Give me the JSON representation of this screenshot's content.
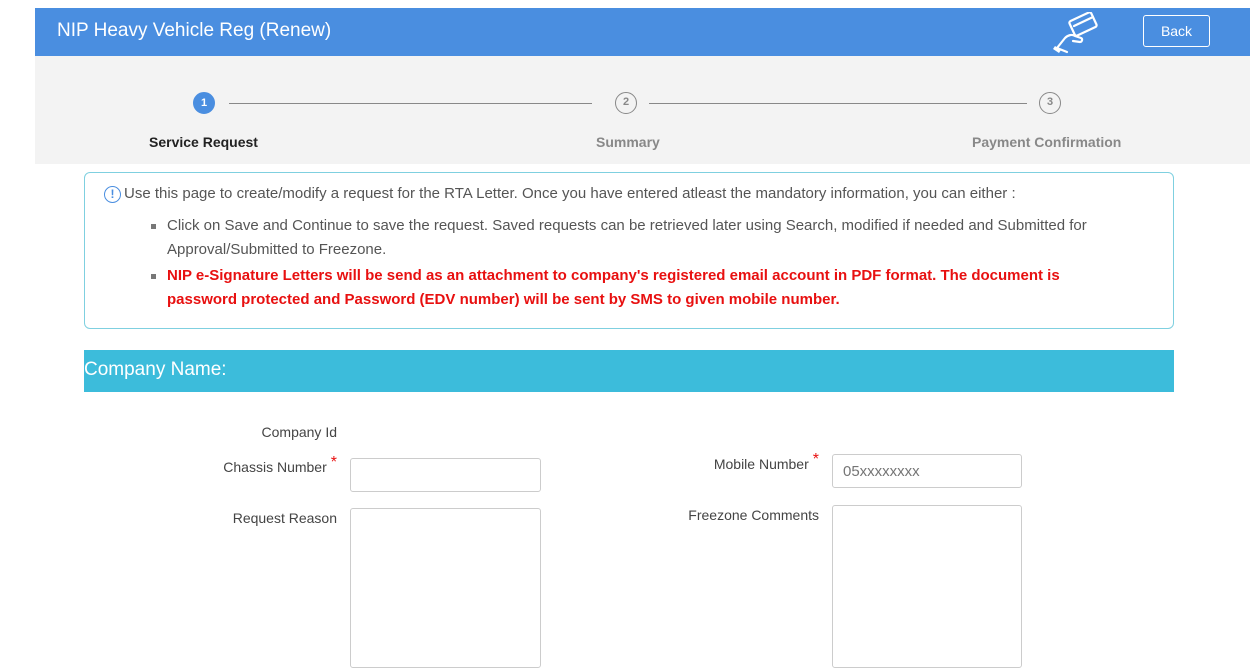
{
  "header": {
    "title": "NIP Heavy Vehicle Reg (Renew)",
    "back_label": "Back",
    "icon": "card-payment-icon"
  },
  "steps": [
    {
      "number": "1",
      "label": "Service Request",
      "active": true
    },
    {
      "number": "2",
      "label": "Summary",
      "active": false
    },
    {
      "number": "3",
      "label": "Payment Confirmation",
      "active": false
    }
  ],
  "info": {
    "intro": "Use this page to create/modify a request for the RTA Letter. Once you have entered atleast the mandatory information, you can either :",
    "bullets": [
      "Click on Save and Continue to save the request. Saved requests can be retrieved later using Search, modified if needed and Submitted for Approval/Submitted to Freezone.",
      "NIP e-Signature Letters will be send as an attachment to company's registered email account in PDF format. The document is password protected and Password (EDV number) will be sent by SMS to given mobile number."
    ]
  },
  "section": {
    "title": "Company Name:"
  },
  "form": {
    "company_id_label": "Company Id",
    "chassis_label": "Chassis Number",
    "chassis_value": "",
    "mobile_label": "Mobile Number",
    "mobile_placeholder": "05xxxxxxxx",
    "request_reason_label": "Request Reason",
    "freezone_comments_label": "Freezone Comments",
    "required_mark": "*"
  },
  "colors": {
    "header": "#4a8ee0",
    "section_bar": "#3cbcdb",
    "required": "#e81010"
  }
}
